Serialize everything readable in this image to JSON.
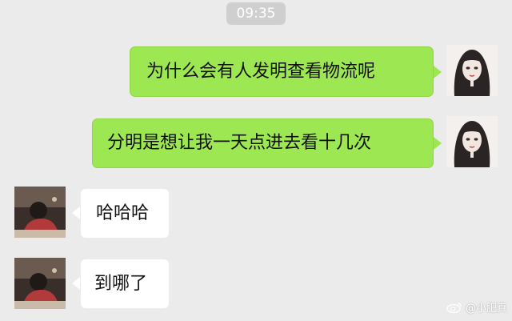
{
  "chat": {
    "timestamp": "09:35",
    "messages": [
      {
        "side": "sent",
        "text": "为什么会有人发明查看物流呢"
      },
      {
        "side": "sent",
        "text": "分明是想让我一天点进去看十几次"
      },
      {
        "side": "received",
        "text": "哈哈哈"
      },
      {
        "side": "received",
        "text": "到哪了"
      }
    ]
  },
  "watermark": {
    "text": "@小肥真",
    "logo": "weibo-logo"
  },
  "colors": {
    "background": "#ebebeb",
    "sent_bubble": "#9de752",
    "received_bubble": "#ffffff",
    "timestamp_bg": "#cfcfcf"
  }
}
